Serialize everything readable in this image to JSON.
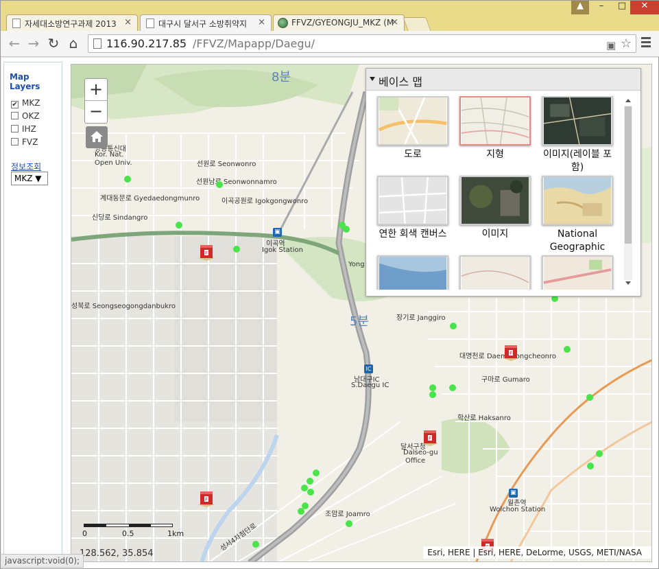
{
  "browser": {
    "tabs": [
      {
        "label": "자세대소방연구과제 2013",
        "close": "×"
      },
      {
        "label": "대구시 달서구 소방취약지",
        "close": "×"
      },
      {
        "label": "FFVZ/GYEONGJU_MKZ (M",
        "close": "×"
      }
    ],
    "url_host": "116.90.217.85",
    "url_path": "/FFVZ/Mapapp/Daegu/",
    "nav": {
      "back": "←",
      "forward": "→",
      "reload": "↻",
      "home": "⌂"
    },
    "window": {
      "user": "▲",
      "minimize": "–",
      "maximize": "□",
      "close": "✕"
    }
  },
  "left_panel": {
    "title": "Map Layers",
    "layers": [
      {
        "label": "MKZ",
        "checked": "✔"
      },
      {
        "label": "OKZ",
        "checked": ""
      },
      {
        "label": "IHZ",
        "checked": ""
      },
      {
        "label": "FVZ",
        "checked": ""
      }
    ],
    "info_title": "정보조회",
    "select_value": "MKZ ▼"
  },
  "map": {
    "zoom_in": "+",
    "zoom_out": "−",
    "scale": {
      "l0": "0",
      "l1": "0.5",
      "l2": "1km"
    },
    "coords": "128.562, 35.854",
    "attribution": "Esri, HERE | Esri, HERE, DeLorme, USGS, METI/NASA",
    "minute_labels": [
      "8분",
      "5분"
    ],
    "road_labels": [
      "선원로 Seonwonro",
      "선원남로 Seonwonnamro",
      "이곡공원로 Igokgongwonro",
      "계대동문로 Gyedaedongmunro",
      "신당로 Sindangro",
      "이곡역",
      "Igok Station",
      "성북로 Seongseogongdanbukro",
      "장기로 Janggiro",
      "대명천로 Daemyeongcheonro",
      "구마로 Gumaro",
      "남대구IC",
      "S.Daegu IC",
      "학산로 Haksanro",
      "달서구청",
      "Dalseo-gu",
      "Office",
      "월촌역",
      "Wolchon Station",
      "조암로 Joamro",
      "성서4차첨단로",
      "Kor. Nat.",
      "Open Univ.",
      "방송통신대",
      "Yong"
    ]
  },
  "basemap": {
    "title": "베이스 맵",
    "items": [
      {
        "label": "도로"
      },
      {
        "label": "지형"
      },
      {
        "label": "이미지(레이블 포함)"
      },
      {
        "label": "연한 회색 캔버스"
      },
      {
        "label": "이미지"
      },
      {
        "label": "National Geographic"
      }
    ]
  },
  "status_text": "javascript:void(0);"
}
